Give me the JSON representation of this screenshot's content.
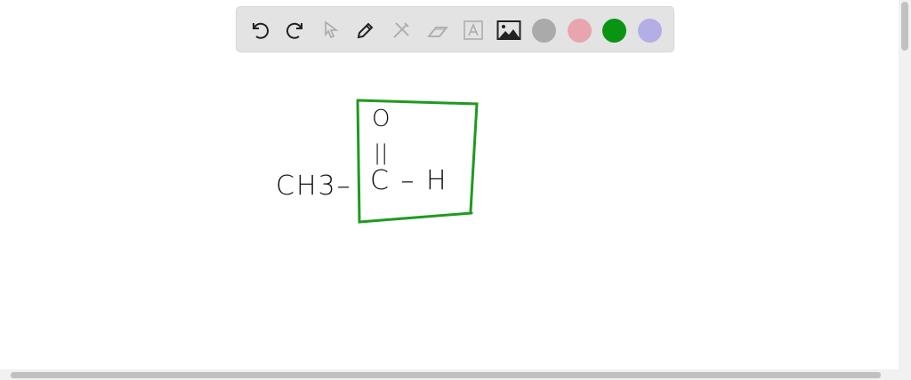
{
  "toolbar": {
    "tools": [
      "undo-icon",
      "redo-icon",
      "select-icon",
      "pen-icon",
      "tools-icon",
      "eraser-icon",
      "text-icon",
      "image-icon"
    ],
    "colors": [
      "#aaaaaa",
      "#e8a5ad",
      "#0a9414",
      "#b3aee6"
    ]
  },
  "drawing": {
    "oxygen": "O",
    "double_bond": "||",
    "methyl": "CH3–",
    "carbon_h": "C – H",
    "box_color": "#1f9a1f"
  }
}
